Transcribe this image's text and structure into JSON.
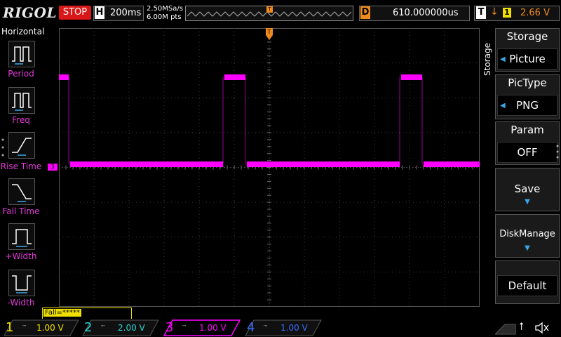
{
  "topbar": {
    "brand": "RIGOL",
    "run_state": "STOP",
    "timebase_letter": "H",
    "timebase": "200ms",
    "sample_rate": "2.50MSa/s",
    "memory_depth": "6.00M pts",
    "trigger_marker": "T",
    "delay_letter": "D",
    "delay": "610.000000us",
    "trigger_letter": "T",
    "trigger_source": "1",
    "trigger_level": "2.66 V"
  },
  "left_panel": {
    "title": "Horizontal",
    "items": [
      {
        "label": "Period"
      },
      {
        "label": "Freq"
      },
      {
        "label": "Rise Time"
      },
      {
        "label": "Fall Time"
      },
      {
        "label": "+Width"
      },
      {
        "label": "-Width"
      }
    ]
  },
  "right_panel": {
    "side_label": "Storage",
    "title": "Storage",
    "storage_value": "Picture",
    "pictype_title": "PicType",
    "pictype_value": "PNG",
    "param_title": "Param",
    "param_value": "OFF",
    "save_label": "Save",
    "disk_label": "DiskManage",
    "default_label": "Default"
  },
  "status": {
    "measurement": "Fall=*****"
  },
  "channels": [
    {
      "num": "1",
      "scale": "1.00 V",
      "color": "#f0e000"
    },
    {
      "num": "2",
      "scale": "2.00 V",
      "color": "#29d3d3"
    },
    {
      "num": "3",
      "scale": "1.00 V",
      "color": "#ff00ff"
    },
    {
      "num": "4",
      "scale": "1.00 V",
      "color": "#3a6bff"
    }
  ],
  "waveform": {
    "channel_marker": "3",
    "color": "#ff00ff",
    "trace": [
      {
        "level": "high",
        "duration": 14
      },
      {
        "level": "low",
        "duration": 220
      },
      {
        "level": "high",
        "duration": 32
      },
      {
        "level": "low",
        "duration": 220
      },
      {
        "level": "high",
        "duration": 32
      },
      {
        "level": "low",
        "duration": 82
      }
    ]
  }
}
